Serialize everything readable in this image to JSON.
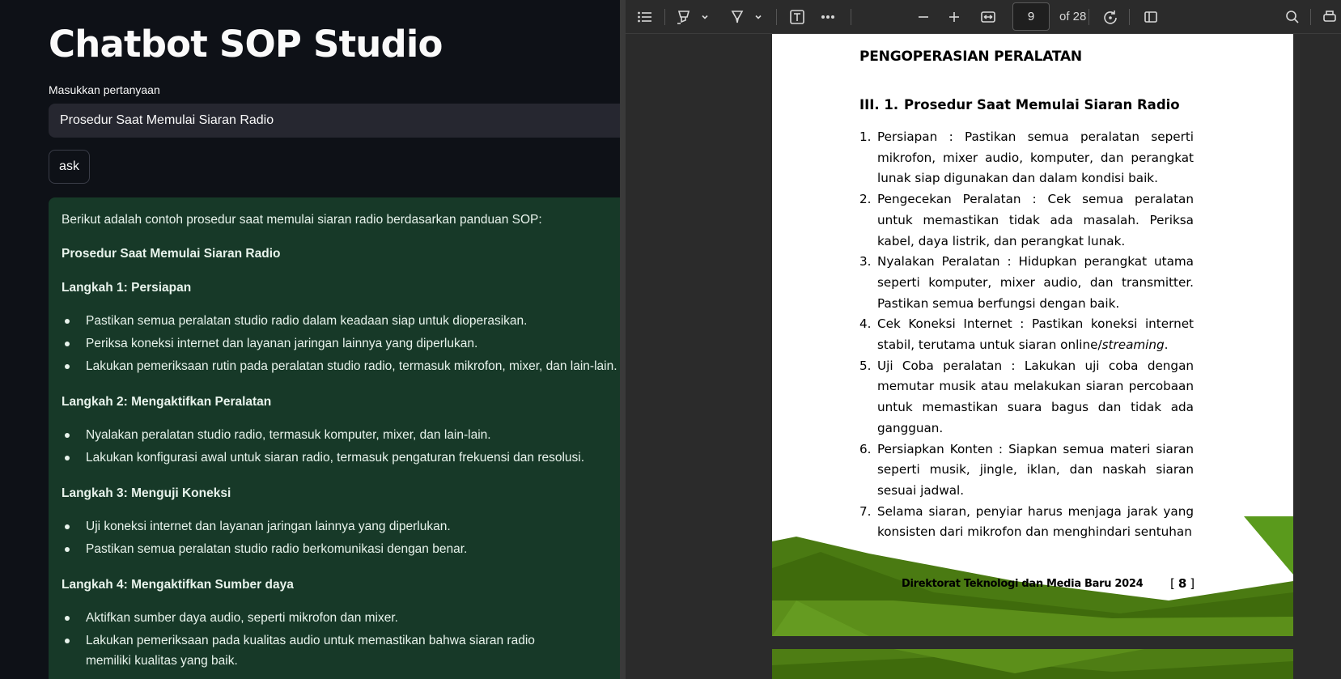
{
  "app": {
    "title": "Chatbot SOP Studio",
    "question_label": "Masukkan pertanyaan",
    "question_value": "Prosedur Saat Memulai Siaran Radio",
    "ask_label": "ask"
  },
  "answer": {
    "intro": "Berikut adalah contoh prosedur saat memulai siaran radio berdasarkan panduan SOP:",
    "heading": "Prosedur Saat Memulai Siaran Radio",
    "steps": [
      {
        "title": "Langkah 1: Persiapan",
        "bullets": [
          "Pastikan semua peralatan studio radio dalam keadaan siap untuk dioperasikan.",
          "Periksa koneksi internet dan layanan jaringan lainnya yang diperlukan.",
          "Lakukan pemeriksaan rutin pada peralatan studio radio, termasuk mikrofon, mixer, dan lain-lain."
        ]
      },
      {
        "title": "Langkah 2: Mengaktifkan Peralatan",
        "bullets": [
          "Nyalakan peralatan studio radio, termasuk komputer, mixer, dan lain-lain.",
          "Lakukan konfigurasi awal untuk siaran radio, termasuk pengaturan frekuensi dan resolusi."
        ]
      },
      {
        "title": "Langkah 3: Menguji Koneksi",
        "bullets": [
          "Uji koneksi internet dan layanan jaringan lainnya yang diperlukan.",
          "Pastikan semua peralatan studio radio berkomunikasi dengan benar."
        ]
      },
      {
        "title": "Langkah 4: Mengaktifkan Sumber daya",
        "bullets": [
          "Aktifkan sumber daya audio, seperti mikrofon dan mixer.",
          "Lakukan pemeriksaan pada kualitas audio untuk memastikan bahwa siaran radio memiliki kualitas yang baik."
        ]
      }
    ]
  },
  "viewer": {
    "toolbar_icons": [
      "contents-icon",
      "highlight-icon",
      "draw-icon",
      "text-icon",
      "more-icon",
      "zoom-out-icon",
      "zoom-in-icon",
      "fit-width-icon",
      "rotate-icon",
      "page-view-icon",
      "search-icon"
    ],
    "current_page": "9",
    "total_pages": "of 28",
    "page": {
      "heading": "PENGOPERASIAN PERALATAN",
      "section_number": "III. 1.",
      "section_title": "Prosedur Saat Memulai Siaran Radio",
      "items": [
        {
          "n": "1.",
          "text": "Persiapan : Pastikan semua peralatan seperti mikrofon, mixer audio, komputer, dan perangkat lunak siap digunakan dan dalam kondisi baik."
        },
        {
          "n": "2.",
          "text": "Pengecekan Peralatan : Cek semua peralatan untuk memastikan tidak ada masalah. Periksa kabel, daya listrik, dan perangkat lunak."
        },
        {
          "n": "3.",
          "text": "Nyalakan Peralatan : Hidupkan perangkat utama seperti komputer, mixer audio, dan transmitter. Pastikan semua berfungsi dengan baik."
        },
        {
          "n": "4.",
          "text_before": "Cek Koneksi Internet : Pastikan koneksi internet stabil, terutama untuk siaran online/",
          "text_italic": "streaming",
          "text_after": "."
        },
        {
          "n": "5.",
          "text": "Uji Coba peralatan : Lakukan uji coba dengan memutar musik atau melakukan siaran percobaan untuk memastikan suara bagus dan tidak ada gangguan."
        },
        {
          "n": "6.",
          "text": "Persiapkan Konten : Siapkan semua materi siaran seperti musik, jingle, iklan, dan naskah siaran sesuai jadwal."
        },
        {
          "n": "7.",
          "text": "Selama siaran, penyiar harus menjaga jarak yang konsisten dari mikrofon dan menghindari sentuhan"
        }
      ],
      "footer": "Direktorat Teknologi dan Media Baru 2024",
      "page_number_open": "[",
      "page_number": "8",
      "page_number_close": "]"
    }
  },
  "colors": {
    "app_bg": "#0e1117",
    "input_bg": "#262730",
    "answer_bg": "#173928",
    "viewer_bg": "#2b2b2b",
    "decor_green": "#4e7d14"
  }
}
